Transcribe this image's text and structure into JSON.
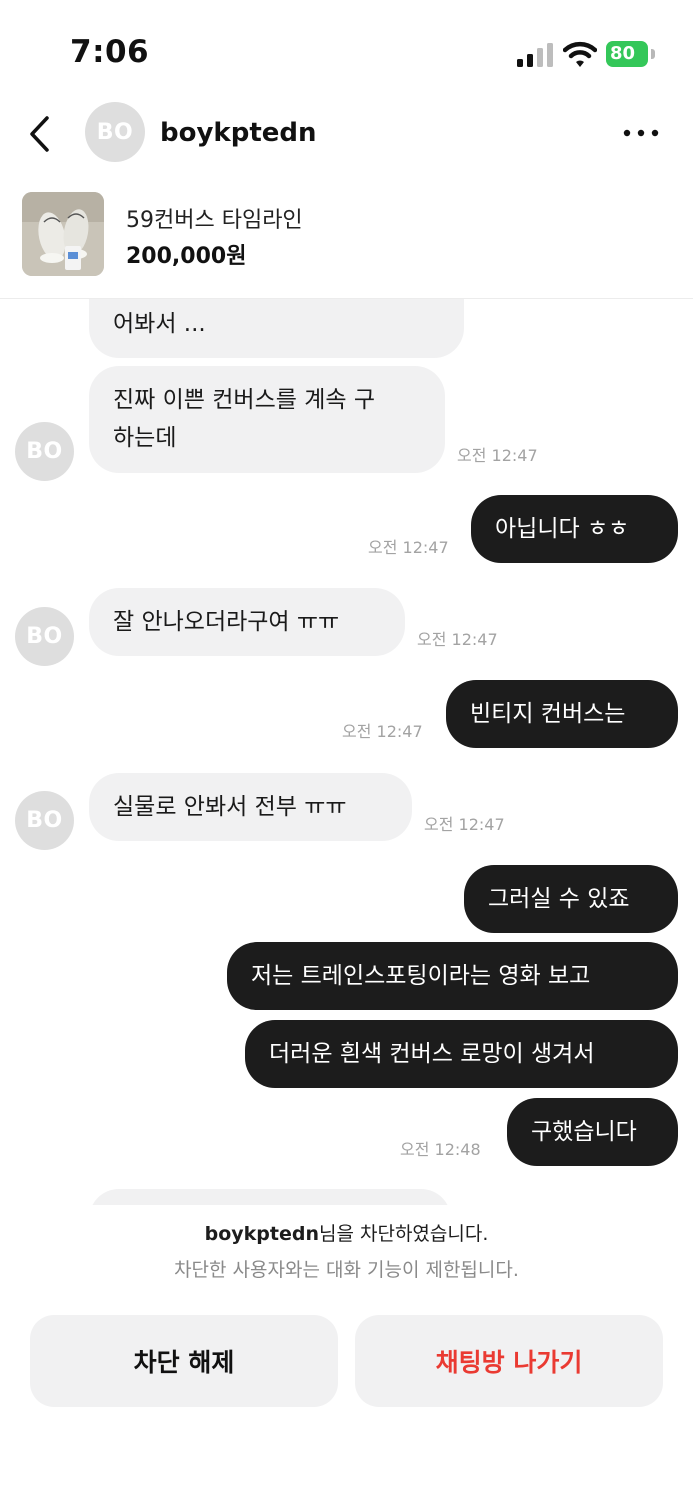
{
  "status_bar": {
    "time": "7:06",
    "battery": "80"
  },
  "header": {
    "avatar_initials": "BO",
    "username": "boykptedn"
  },
  "product": {
    "title": "59컨버스 타임라인",
    "price": "200,000원"
  },
  "messages": [
    {
      "side": "in",
      "text": "어봐서 ..."
    },
    {
      "side": "in",
      "text_line1": "진짜 이쁜 컨버스를 계속 구",
      "text_line2": "하는데",
      "time": "오전 12:47"
    },
    {
      "side": "out",
      "text": "아닙니다 ㅎㅎ",
      "time": "오전 12:47"
    },
    {
      "side": "in",
      "text": "잘 안나오더라구여 ㅠㅠ",
      "time": "오전 12:47"
    },
    {
      "side": "out",
      "text": "빈티지 컨버스는",
      "time": "오전 12:47"
    },
    {
      "side": "in",
      "text": "실물로 안봐서 전부 ㅠㅠ",
      "time": "오전 12:47"
    },
    {
      "side": "out",
      "text": "그러실 수 있죠"
    },
    {
      "side": "out",
      "text": "저는 트레인스포팅이라는 영화 보고"
    },
    {
      "side": "out",
      "text": "더러운 흰색 컨버스 로망이 생겨서"
    },
    {
      "side": "out",
      "text": "구했습니다",
      "time": "오전 12:48"
    }
  ],
  "block_notice": {
    "username": "boykptedn",
    "suffix": "님을 차단하였습니다.",
    "subtext": "차단한 사용자와는 대화 기능이 제한됩니다."
  },
  "buttons": {
    "unblock": "차단 해제",
    "leave": "채팅방 나가기"
  },
  "colors": {
    "leave_button_text": "#ea3a32",
    "outgoing_bubble": "#1c1c1c",
    "incoming_bubble": "#f1f1f2"
  },
  "icons": [
    "back-icon",
    "more-icon",
    "signal-icon",
    "wifi-icon",
    "battery-icon"
  ]
}
